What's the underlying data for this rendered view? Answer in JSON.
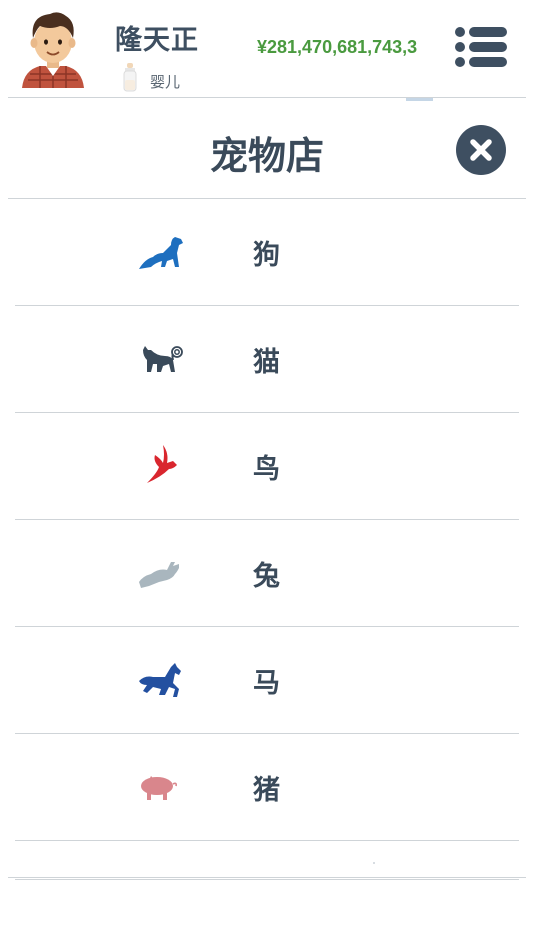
{
  "header": {
    "player_name": "隆天正",
    "life_stage": "婴儿",
    "money": "¥281,470,681,743,3"
  },
  "shop": {
    "title": "宠物店",
    "items": [
      {
        "label": "狗",
        "icon": "dog-icon",
        "color": "#1e6fbf"
      },
      {
        "label": "猫",
        "icon": "cat-icon",
        "color": "#3a4a5a"
      },
      {
        "label": "鸟",
        "icon": "bird-icon",
        "color": "#d9262e"
      },
      {
        "label": "兔",
        "icon": "rabbit-icon",
        "color": "#a9b6be"
      },
      {
        "label": "马",
        "icon": "horse-icon",
        "color": "#2350a0"
      },
      {
        "label": "猪",
        "icon": "pig-icon",
        "color": "#d9868c"
      }
    ]
  },
  "colors": {
    "money": "#4a9a3f",
    "primary": "#3e4f61",
    "divider": "#cfd4d8"
  }
}
